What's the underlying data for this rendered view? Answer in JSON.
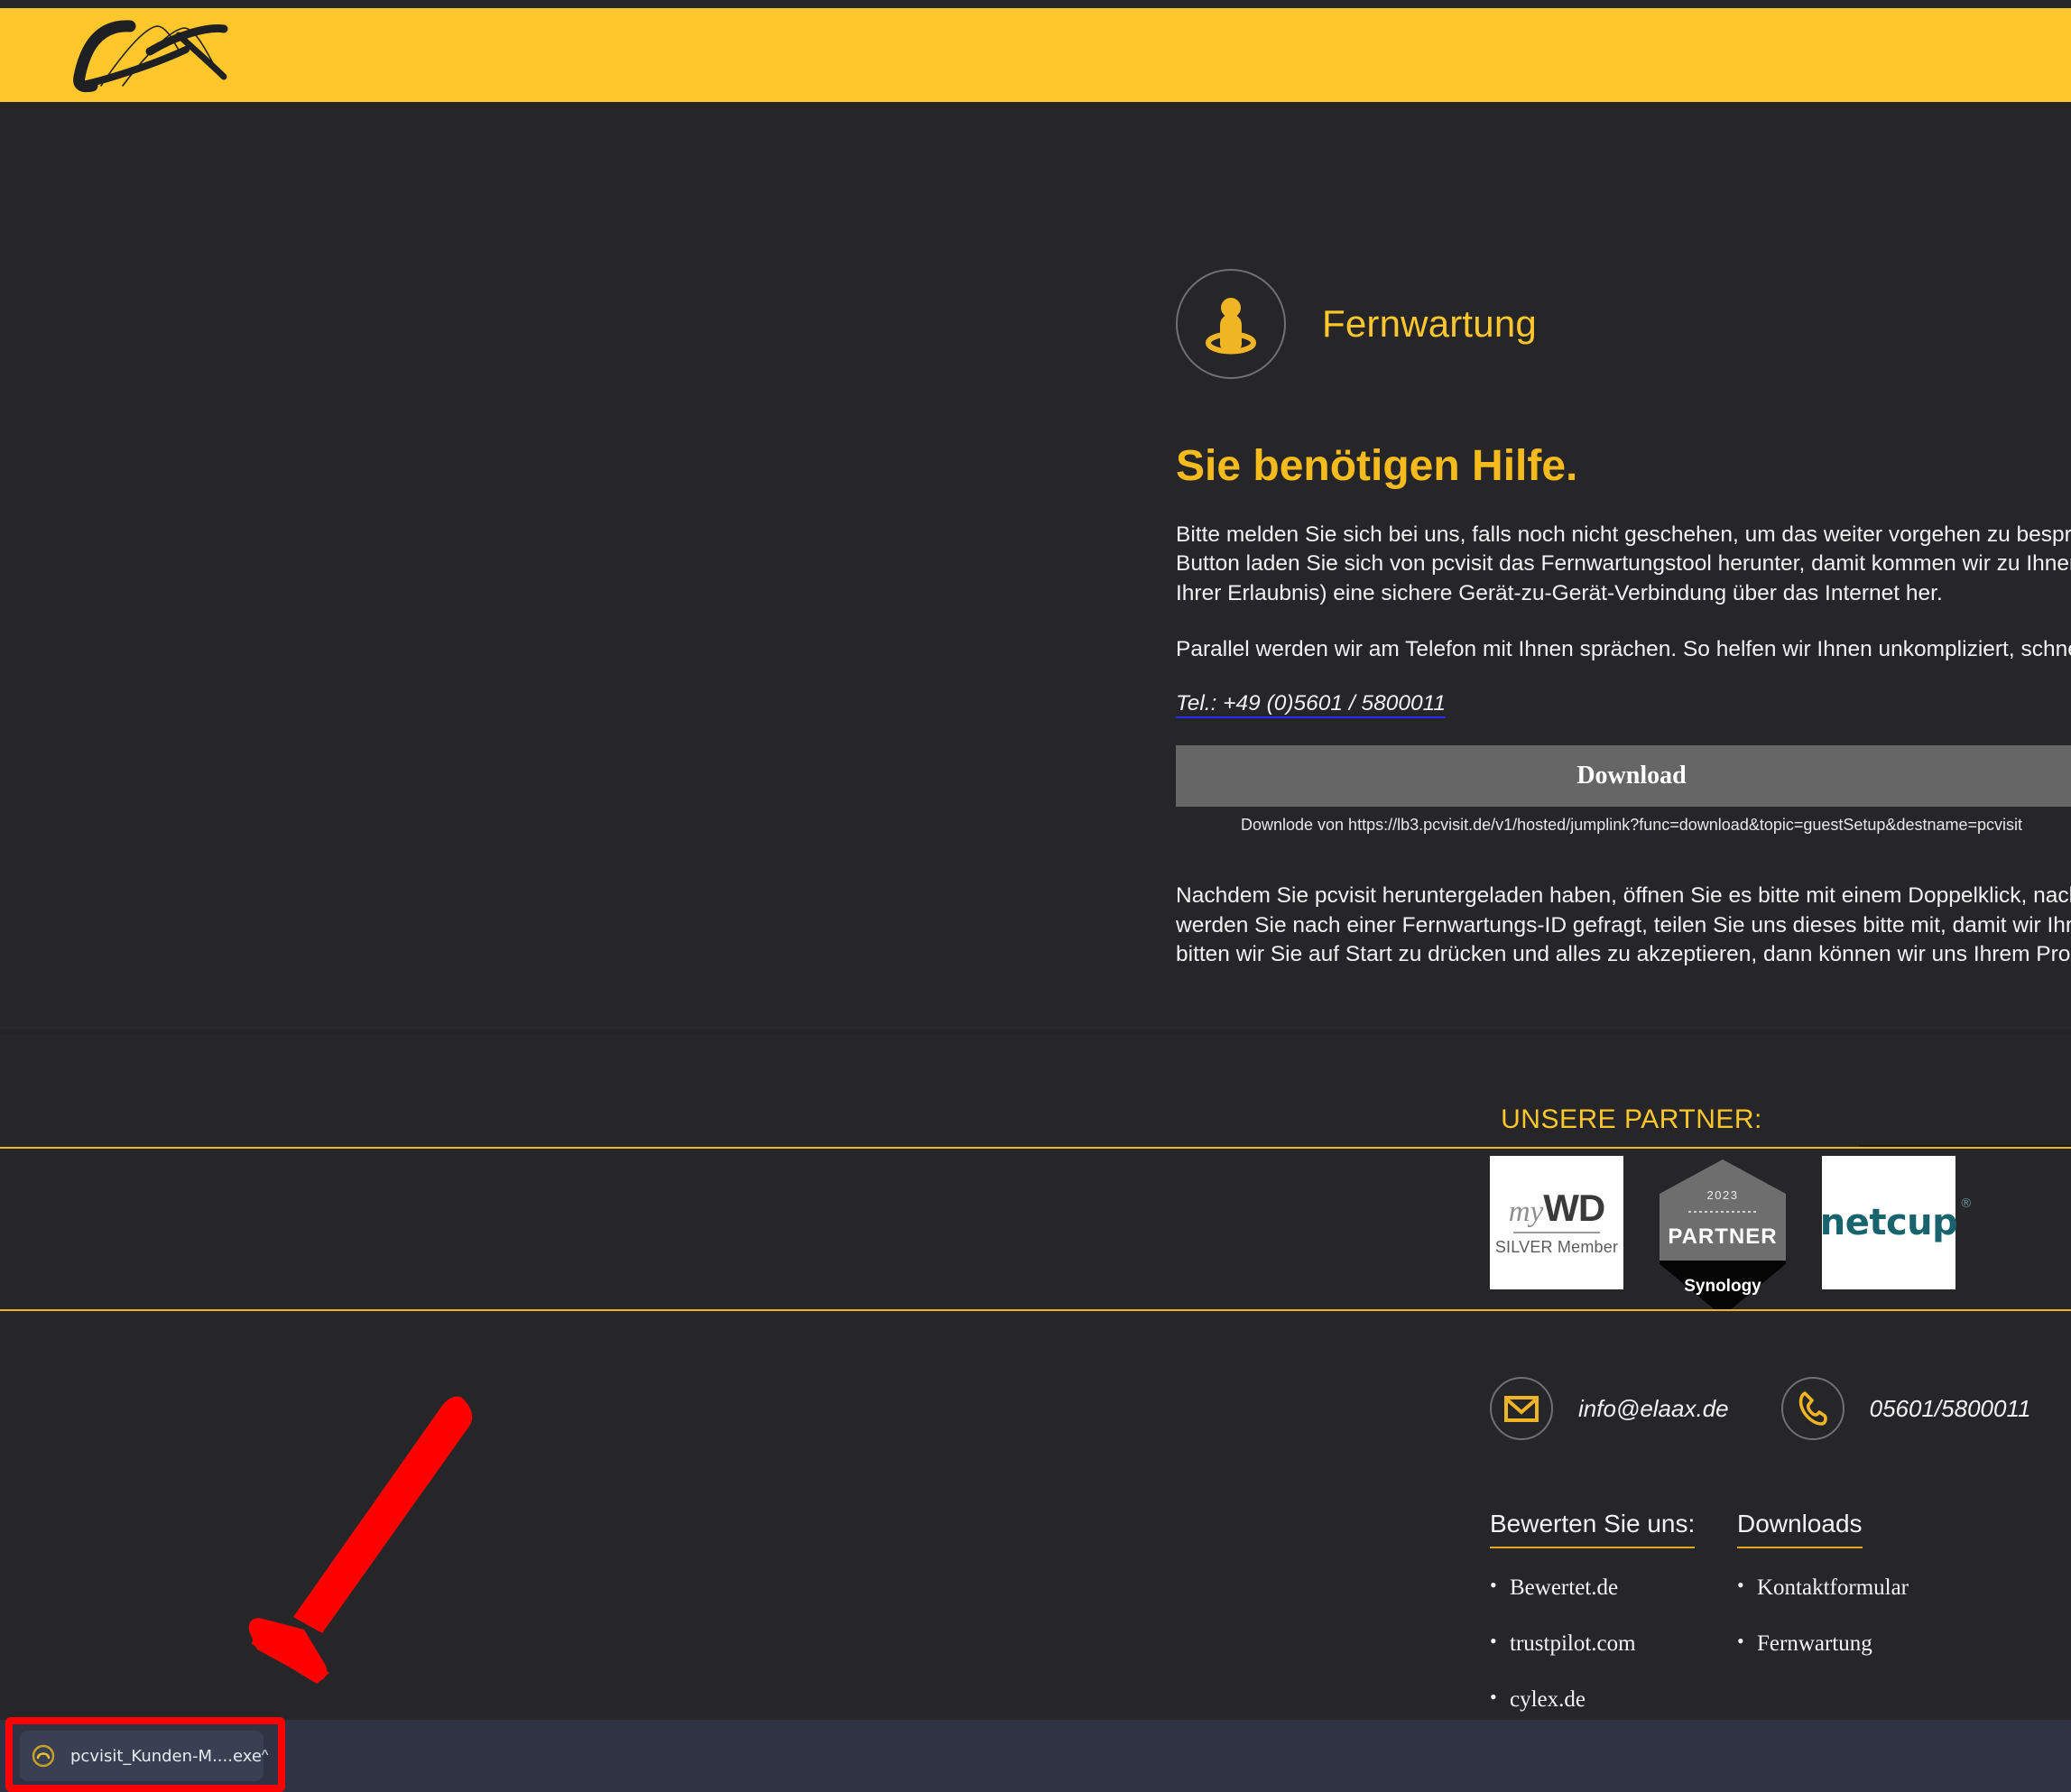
{
  "brand": {
    "logo_name": "elaax-signature-logo",
    "header_color": "#ffc72c"
  },
  "service": {
    "icon": "person-in-ring-icon",
    "title": "Fernwartung"
  },
  "hero": {
    "heading": "Sie benötigen Hilfe.",
    "paragraph_1": "Bitte melden Sie sich bei uns, falls noch nicht geschehen, um das weiter vorgehen zu besprechen. Ü\nButton laden Sie sich von pcvisit das Fernwartungstool herunter, damit kommen wir zu Ihnen online!\nIhrer Erlaubnis) eine sichere Gerät-zu-Gerät-Verbindung über das Internet her.",
    "paragraph_2": "Parallel werden wir am Telefon mit Ihnen sprächen. So helfen wir Ihnen unkompliziert, schnell und ü",
    "phone_link": "Tel.: +49 (0)5601 / 5800011",
    "download_button": "Download",
    "download_note": "Downlode von https://lb3.pcvisit.de/v1/hosted/jumplink?func=download&topic=guestSetup&destname=pcvisit",
    "paragraph_3": "Nachdem Sie pcvisit heruntergeladen haben, öffnen Sie es bitte mit einem Doppelklick, nach dem S\nwerden Sie nach einer Fernwartungs-ID gefragt, teilen Sie uns dieses bitte mit, damit wir Ihnen dies\nbitten wir Sie auf Start zu drücken und alles zu akzeptieren, dann können wir uns Ihrem Problem an"
  },
  "partners": {
    "title": "UNSERE PARTNER:",
    "accent_color": "#f0b323",
    "logos": [
      {
        "name": "mywd-silver-member-logo",
        "my": "my",
        "wd": "WD",
        "sub": "SILVER Member"
      },
      {
        "name": "synology-partner-2023-badge",
        "year": "2023",
        "label": "PARTNER",
        "brand": "Synology"
      },
      {
        "name": "netcup-logo",
        "text": "netcup",
        "mark": "®"
      }
    ]
  },
  "contact": {
    "email_icon": "envelope-icon",
    "email": "info@elaax.de",
    "phone_icon": "phone-icon",
    "phone": "05601/5800011"
  },
  "footer_columns": [
    {
      "heading": "Bewerten Sie uns:",
      "items": [
        "Bewertet.de",
        "trustpilot.com",
        "cylex.de"
      ]
    },
    {
      "heading": "Downloads",
      "items": [
        "Kontaktformular",
        "Fernwartung"
      ]
    }
  ],
  "download_bar": {
    "file_name": "pcvisit_Kunden-M....exe",
    "file_icon": "download-progress-icon",
    "expand_icon": "chevron-up-icon",
    "bar_color": "#2f3343"
  },
  "annotation": {
    "arrow_color": "#ff0000",
    "highlight_color": "#ff0000"
  }
}
